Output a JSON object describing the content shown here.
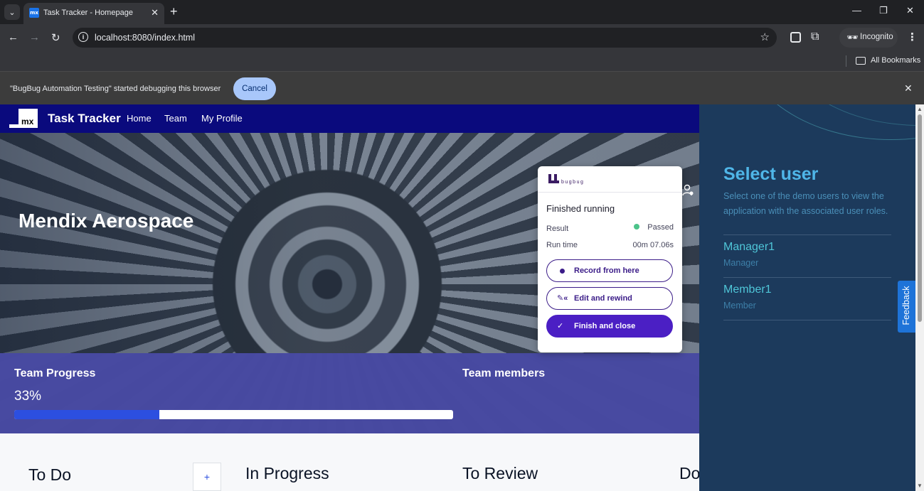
{
  "browser": {
    "tab_title": "Task Tracker - Homepage",
    "favicon_text": "mx",
    "url": "localhost:8080/index.html",
    "profile_label": "Incognito",
    "bookmarks_label": "All Bookmarks",
    "debug_message": "\"BugBug Automation Testing\" started debugging this browser",
    "debug_cancel": "Cancel"
  },
  "app": {
    "logo_text": "mx",
    "brand": "Task Tracker",
    "nav": [
      "Home",
      "Team",
      "My Profile"
    ],
    "hero_title": "Mendix Aerospace",
    "team_progress_label": "Team Progress",
    "team_progress_value": "33%",
    "team_progress_fraction": 0.33,
    "team_members_label": "Team members",
    "columns": [
      "To Do",
      "In Progress",
      "To Review",
      "Do"
    ],
    "add_label": "+"
  },
  "bugbug": {
    "logo_text": "bugbug",
    "status": "Finished running",
    "result_label": "Result",
    "result_value": "Passed",
    "runtime_label": "Run time",
    "runtime_value": "00m 07.06s",
    "record_label": "Record from here",
    "edit_label": "Edit and rewind",
    "finish_label": "Finish and close"
  },
  "side": {
    "title": "Select user",
    "description": "Select one of the demo users to view the application with the associated user roles.",
    "users": [
      {
        "name": "Manager1",
        "role": "Manager"
      },
      {
        "name": "Member1",
        "role": "Member"
      }
    ],
    "feedback_label": "Feedback"
  },
  "colors": {
    "nav_bg": "#0a0a7d",
    "progress_fill": "#2c4fe0",
    "bugbug_primary": "#4b1fc4",
    "side_bg": "#1c3a5c"
  }
}
